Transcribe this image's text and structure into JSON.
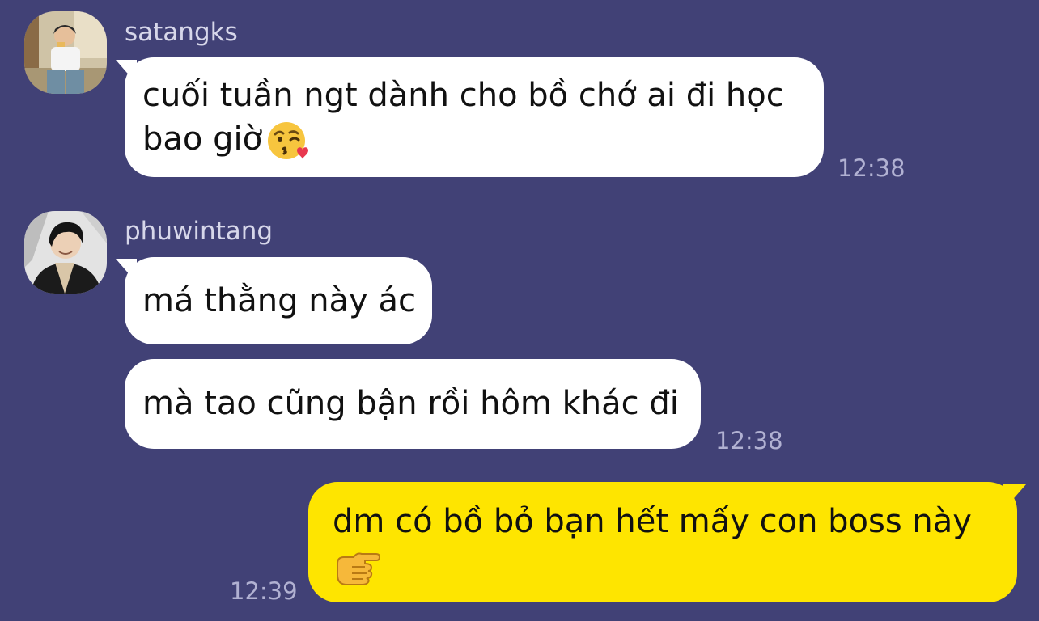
{
  "chat": {
    "messages": [
      {
        "sender": "satangks",
        "lines": [
          "cuối tuần ngt dành cho bồ chớ ai đi học",
          "bao giờ"
        ],
        "emoji": "kissing-face-icon",
        "time": "12:38"
      },
      {
        "sender": "phuwintang",
        "lines": [
          "má thằng này ác"
        ]
      },
      {
        "lines": [
          "mà tao cũng bận rồi hôm khác đi"
        ],
        "time": "12:38"
      },
      {
        "lines": [
          "dm có bồ bỏ bạn hết mấy con boss này"
        ],
        "emoji": "pointing-hand-icon",
        "time": "12:39",
        "outgoing": true
      }
    ]
  },
  "colors": {
    "background": "#414176",
    "incoming_bubble": "#ffffff",
    "outgoing_bubble": "#fee500"
  }
}
